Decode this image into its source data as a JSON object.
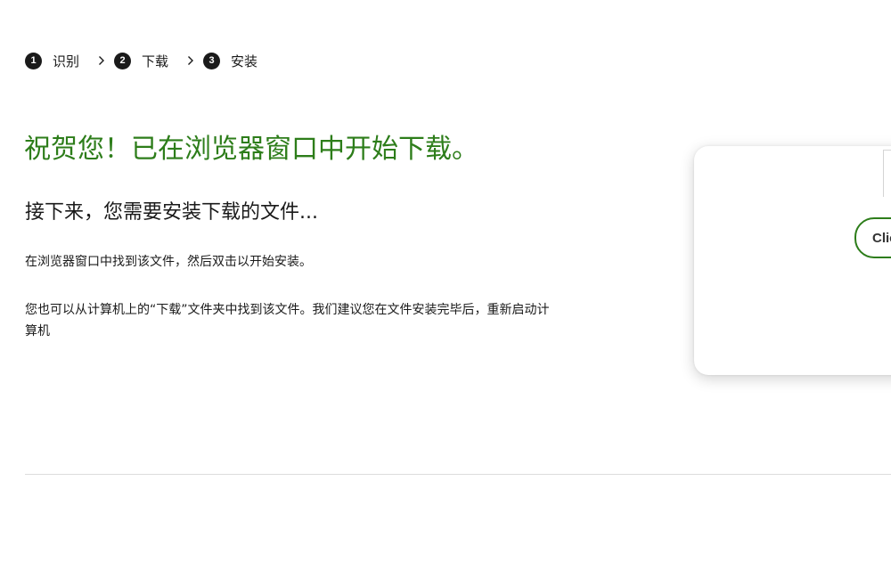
{
  "steps": [
    {
      "number": "1",
      "label": "识别"
    },
    {
      "number": "2",
      "label": "下载"
    },
    {
      "number": "3",
      "label": "安装"
    }
  ],
  "headline": "祝贺您！已在浏览器窗口中开始下载。",
  "subheading": "接下来，您需要安装下载的文件...",
  "paragraphs": {
    "find_file": "在浏览器窗口中找到该文件，然后双击以开始安装。",
    "downloads_folder": "您也可以从计算机上的“下载”文件夹中找到该文件。我们建议您在文件安装完毕后，重新启动计算机"
  },
  "card": {
    "button_label": "Click"
  },
  "colors": {
    "accent_green": "#2d7d1a",
    "text": "#1a1a1a"
  },
  "icons": {
    "step_separator": "chevron-right-icon"
  }
}
